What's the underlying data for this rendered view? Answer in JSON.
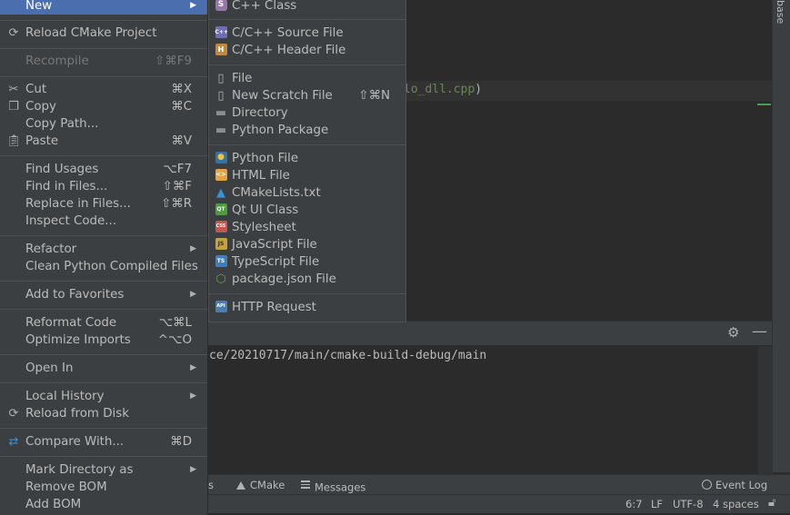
{
  "editor": {
    "code_fragment": "lo_dll.cpp",
    "code_paren": ")"
  },
  "right_strip": {
    "tab_label": "base"
  },
  "run_panel": {
    "output_line": "ce/20210717/main/cmake-build-debug/main"
  },
  "bottom_tabs": {
    "partial_label": "s",
    "cmake_label": "CMake",
    "messages_label": "Messages",
    "event_log_label": "Event Log"
  },
  "status_bar": {
    "position": "6:7",
    "line_sep": "LF",
    "encoding": "UTF-8",
    "indent": "4 spaces"
  },
  "context_menu": {
    "items": [
      {
        "label": "New",
        "shortcut": "",
        "submenu": true
      },
      {
        "label": "Reload CMake Project",
        "shortcut": "",
        "icon": "reload-icon"
      },
      {
        "label": "Recompile",
        "shortcut": "⇧⌘F9",
        "disabled": true
      },
      {
        "label": "Cut",
        "shortcut": "⌘X",
        "icon": "scissors-icon"
      },
      {
        "label": "Copy",
        "shortcut": "⌘C",
        "icon": "copy-icon"
      },
      {
        "label": "Copy Path...",
        "shortcut": ""
      },
      {
        "label": "Paste",
        "shortcut": "⌘V",
        "icon": "clipboard-icon"
      },
      {
        "label": "Find Usages",
        "shortcut": "⌥F7"
      },
      {
        "label": "Find in Files...",
        "shortcut": "⇧⌘F"
      },
      {
        "label": "Replace in Files...",
        "shortcut": "⇧⌘R"
      },
      {
        "label": "Inspect Code...",
        "shortcut": ""
      },
      {
        "label": "Refactor",
        "shortcut": "",
        "submenu": true
      },
      {
        "label": "Clean Python Compiled Files",
        "shortcut": ""
      },
      {
        "label": "Add to Favorites",
        "shortcut": "",
        "submenu": true
      },
      {
        "label": "Reformat Code",
        "shortcut": "⌥⌘L"
      },
      {
        "label": "Optimize Imports",
        "shortcut": "^⌥O"
      },
      {
        "label": "Open In",
        "shortcut": "",
        "submenu": true
      },
      {
        "label": "Local History",
        "shortcut": "",
        "submenu": true
      },
      {
        "label": "Reload from Disk",
        "shortcut": "",
        "icon": "reload-icon"
      },
      {
        "label": "Compare With...",
        "shortcut": "⌘D",
        "icon": "compare-icon"
      },
      {
        "label": "Mark Directory as",
        "shortcut": "",
        "submenu": true
      },
      {
        "label": "Remove BOM",
        "shortcut": ""
      },
      {
        "label": "Add BOM",
        "shortcut": ""
      }
    ]
  },
  "new_submenu": {
    "items": [
      {
        "label": "C++ Class",
        "icon": "cpp-class-icon",
        "glyph": "S",
        "color": "#9876aa"
      },
      {
        "label": "C/C++ Source File",
        "icon": "cpp-source-icon",
        "glyph": "C++",
        "color": "#6e6eb5"
      },
      {
        "label": "C/C++ Header File",
        "icon": "cpp-header-icon",
        "glyph": "H",
        "color": "#c08a3e"
      },
      {
        "label": "File",
        "icon": "file-icon"
      },
      {
        "label": "New Scratch File",
        "shortcut": "⇧⌘N",
        "icon": "scratch-file-icon"
      },
      {
        "label": "Directory",
        "icon": "folder-icon"
      },
      {
        "label": "Python Package",
        "icon": "python-package-icon"
      },
      {
        "label": "Python File",
        "icon": "python-icon",
        "color": "#3572a5"
      },
      {
        "label": "HTML File",
        "icon": "html-icon",
        "color": "#e8a33d"
      },
      {
        "label": "CMakeLists.txt",
        "icon": "cmake-icon",
        "color": "#3d8ed3"
      },
      {
        "label": "Qt UI Class",
        "icon": "qt-icon",
        "glyph": "QT",
        "color": "#4e9a3e"
      },
      {
        "label": "Stylesheet",
        "icon": "css-icon",
        "glyph": "CSS",
        "color": "#c75450"
      },
      {
        "label": "JavaScript File",
        "icon": "javascript-icon",
        "glyph": "JS",
        "color": "#c7a13a"
      },
      {
        "label": "TypeScript File",
        "icon": "typescript-icon",
        "glyph": "TS",
        "color": "#3d7fbd"
      },
      {
        "label": "package.json File",
        "icon": "nodejs-icon",
        "color": "#6a9a4e"
      },
      {
        "label": "HTTP Request",
        "icon": "http-request-icon",
        "glyph": "API",
        "color": "#4b7db0"
      }
    ]
  }
}
